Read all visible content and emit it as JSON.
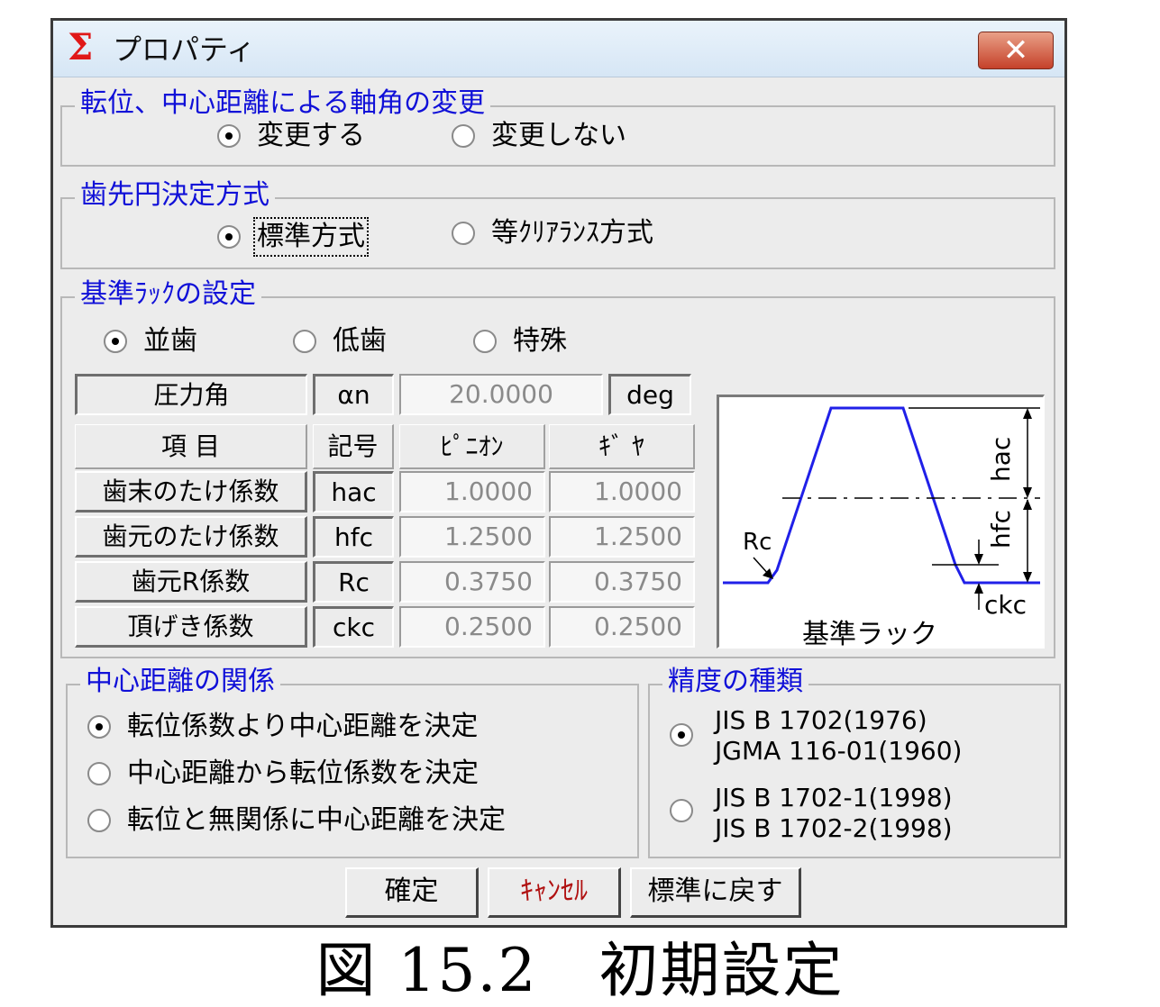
{
  "window": {
    "title": "プロパティ",
    "close_label": "✕"
  },
  "group_shaft": {
    "legend": "転位、中心距離による軸角の変更",
    "options": [
      {
        "label": "変更する",
        "checked": true
      },
      {
        "label": "変更しない",
        "checked": false
      }
    ]
  },
  "group_tip": {
    "legend": "歯先円決定方式",
    "options": [
      {
        "label": "標準方式",
        "checked": true
      },
      {
        "label": "等ｸﾘｱﾗﾝｽ方式",
        "checked": false
      }
    ]
  },
  "group_rack": {
    "legend": "基準ﾗｯｸの設定",
    "options": [
      {
        "label": "並歯",
        "checked": true
      },
      {
        "label": "低歯",
        "checked": false
      },
      {
        "label": "特殊",
        "checked": false
      }
    ],
    "pressure_angle": {
      "label": "圧力角",
      "symbol": "αn",
      "value": "20.0000",
      "unit": "deg"
    },
    "headers": {
      "item": "項 目",
      "symbol": "記号",
      "pinion": "ﾋﾟﾆｵﾝ",
      "gear": "ｷﾞ ﾔ"
    },
    "rows": [
      {
        "label": "歯末のたけ係数",
        "symbol": "hac",
        "pinion": "1.0000",
        "gear": "1.0000"
      },
      {
        "label": "歯元のたけ係数",
        "symbol": "hfc",
        "pinion": "1.2500",
        "gear": "1.2500"
      },
      {
        "label": "歯元R係数",
        "symbol": "Rc",
        "pinion": "0.3750",
        "gear": "0.3750"
      },
      {
        "label": "頂げき係数",
        "symbol": "ckc",
        "pinion": "0.2500",
        "gear": "0.2500"
      }
    ],
    "diagram": {
      "caption": "基準ラック",
      "hac": "hac",
      "hfc": "hfc",
      "rc": "Rc",
      "ckc": "ckc",
      "line_color": "#2020e8"
    }
  },
  "group_center": {
    "legend": "中心距離の関係",
    "options": [
      {
        "label": "転位係数より中心距離を決定",
        "checked": true
      },
      {
        "label": "中心距離から転位係数を決定",
        "checked": false
      },
      {
        "label": "転位と無関係に中心距離を決定",
        "checked": false
      }
    ]
  },
  "group_accuracy": {
    "legend": "精度の種類",
    "options": [
      {
        "line1": "JIS B 1702(1976)",
        "line2": "JGMA 116-01(1960)",
        "checked": true
      },
      {
        "line1": "JIS B 1702-1(1998)",
        "line2": "JIS B 1702-2(1998)",
        "checked": false
      }
    ]
  },
  "buttons": {
    "ok": "確定",
    "cancel": "ｷｬﾝｾﾙ",
    "default": "標準に戻す",
    "cancel_color": "#b01010"
  },
  "caption": "図 15.2　初期設定",
  "colors": {
    "legend": "#1010d8",
    "close": "#c5412a"
  }
}
